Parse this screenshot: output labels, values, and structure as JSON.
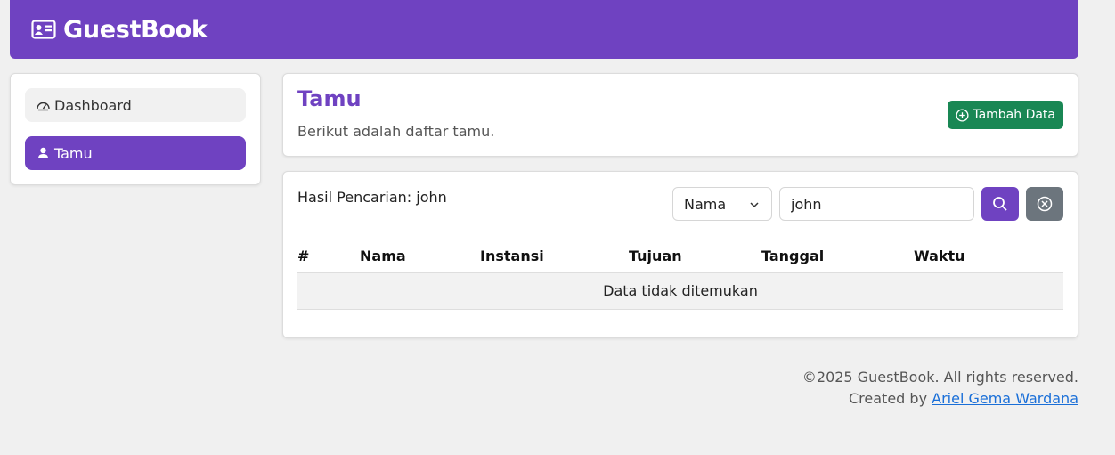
{
  "app": {
    "brand": "GuestBook",
    "brand_icon": "id-card-icon",
    "accent": "#6f42c1"
  },
  "sidebar": {
    "items": [
      {
        "label": "Dashboard",
        "icon": "speedometer-icon",
        "active": false
      },
      {
        "label": "Tamu",
        "icon": "person-icon",
        "active": true
      }
    ]
  },
  "header": {
    "title": "Tamu",
    "subtitle": "Berikut adalah daftar tamu.",
    "add_button": "Tambah Data",
    "add_icon": "plus-circle-icon",
    "add_color": "#198754"
  },
  "search": {
    "result_label": "Hasil Pencarian: john",
    "field_selected": "Nama",
    "query": "john",
    "search_icon": "search-icon",
    "reset_icon": "x-circle-icon",
    "reset_color": "#6c757d"
  },
  "table": {
    "columns": [
      "#",
      "Nama",
      "Instansi",
      "Tujuan",
      "Tanggal",
      "Waktu"
    ],
    "empty_message": "Data tidak ditemukan"
  },
  "footer": {
    "copyright": "©2025 GuestBook. All rights reserved.",
    "created_by": "Created by",
    "author": "Ariel Gema Wardana"
  }
}
